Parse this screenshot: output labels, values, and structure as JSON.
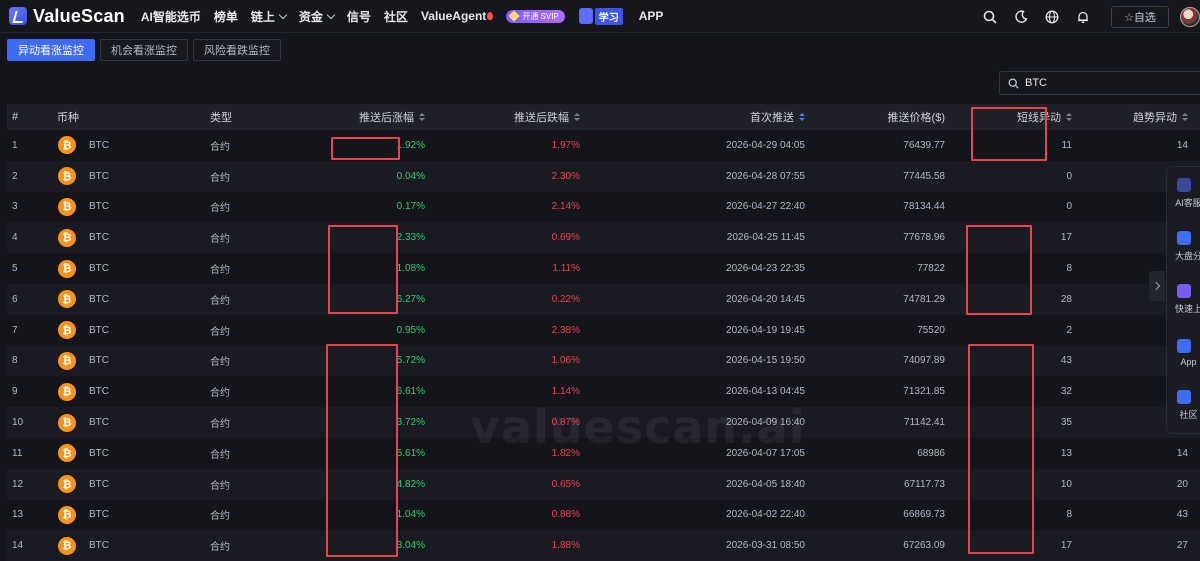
{
  "brand": {
    "name": "ValueScan"
  },
  "nav": {
    "items": [
      {
        "label": "AI智能选币",
        "has_dropdown": false
      },
      {
        "label": "榜单",
        "has_dropdown": false
      },
      {
        "label": "链上",
        "has_dropdown": true
      },
      {
        "label": "资金",
        "has_dropdown": true
      },
      {
        "label": "信号",
        "has_dropdown": false
      },
      {
        "label": "社区",
        "has_dropdown": false
      },
      {
        "label": "ValueAgent",
        "has_dropdown": false
      }
    ],
    "svip_label": "开通 SVIP",
    "learn_label": "学习",
    "app_label": "APP",
    "watchlist_label": "☆自选"
  },
  "tabs": [
    {
      "label": "异动看涨监控",
      "active": true
    },
    {
      "label": "机会看涨监控",
      "active": false
    },
    {
      "label": "风险看跌监控",
      "active": false
    }
  ],
  "search": {
    "value": "BTC"
  },
  "table": {
    "headers": {
      "idx": "#",
      "coin": "币种",
      "type": "类型",
      "up": "推送后涨幅",
      "down": "推送后跌幅",
      "time": "首次推送",
      "price": "推送价格($)",
      "short": "短线异动",
      "trend": "趋势异动"
    },
    "rows": [
      {
        "idx": "1",
        "coin": "BTC",
        "type": "合约",
        "up": "1.92%",
        "down": "1.97%",
        "time": "2026-04-29 04:05",
        "price": "76439.77",
        "short": "11",
        "trend": "14"
      },
      {
        "idx": "2",
        "coin": "BTC",
        "type": "合约",
        "up": "0.04%",
        "down": "2.30%",
        "time": "2026-04-28 07:55",
        "price": "77445.58",
        "short": "0",
        "trend": "5"
      },
      {
        "idx": "3",
        "coin": "BTC",
        "type": "合约",
        "up": "0.17%",
        "down": "2.14%",
        "time": "2026-04-27 22:40",
        "price": "78134.44",
        "short": "0",
        "trend": "1"
      },
      {
        "idx": "4",
        "coin": "BTC",
        "type": "合约",
        "up": "2.33%",
        "down": "0.69%",
        "time": "2026-04-25 11:45",
        "price": "77678.96",
        "short": "17",
        "trend": "34"
      },
      {
        "idx": "5",
        "coin": "BTC",
        "type": "合约",
        "up": "1.08%",
        "down": "1.11%",
        "time": "2026-04-23 22:35",
        "price": "77822",
        "short": "8",
        "trend": "16"
      },
      {
        "idx": "6",
        "coin": "BTC",
        "type": "合约",
        "up": "6.27%",
        "down": "0.22%",
        "time": "2026-04-20 14:45",
        "price": "74781.29",
        "short": "28",
        "trend": "30"
      },
      {
        "idx": "7",
        "coin": "BTC",
        "type": "合约",
        "up": "0.95%",
        "down": "2.38%",
        "time": "2026-04-19 19:45",
        "price": "75520",
        "short": "2",
        "trend": "4"
      },
      {
        "idx": "8",
        "coin": "BTC",
        "type": "合约",
        "up": "5.72%",
        "down": "1.06%",
        "time": "2026-04-15 19:50",
        "price": "74097.89",
        "short": "43",
        "trend": "39"
      },
      {
        "idx": "9",
        "coin": "BTC",
        "type": "合约",
        "up": "6.61%",
        "down": "1.14%",
        "time": "2026-04-13 04:45",
        "price": "71321.85",
        "short": "32",
        "trend": "38"
      },
      {
        "idx": "10",
        "coin": "BTC",
        "type": "合约",
        "up": "3.72%",
        "down": "0.87%",
        "time": "2026-04-09 16:40",
        "price": "71142.41",
        "short": "35",
        "trend": "41"
      },
      {
        "idx": "11",
        "coin": "BTC",
        "type": "合约",
        "up": "5.61%",
        "down": "1.82%",
        "time": "2026-04-07 17:05",
        "price": "68986",
        "short": "13",
        "trend": "14"
      },
      {
        "idx": "12",
        "coin": "BTC",
        "type": "合约",
        "up": "4.82%",
        "down": "0.65%",
        "time": "2026-04-05 18:40",
        "price": "67117.73",
        "short": "10",
        "trend": "20"
      },
      {
        "idx": "13",
        "coin": "BTC",
        "type": "合约",
        "up": "1.04%",
        "down": "0.88%",
        "time": "2026-04-02 22:40",
        "price": "66869.73",
        "short": "8",
        "trend": "43"
      },
      {
        "idx": "14",
        "coin": "BTC",
        "type": "合约",
        "up": "3.04%",
        "down": "1.88%",
        "time": "2026-03-31 08:50",
        "price": "67263.09",
        "short": "17",
        "trend": "27"
      }
    ]
  },
  "watermark": "valuescan.ai",
  "side_panel": [
    {
      "label": "AI客服",
      "color": "#3b4a9e"
    },
    {
      "label": "大盘分",
      "color": "#3d6df2"
    },
    {
      "label": "快速上",
      "color": "#7b5cf0"
    },
    {
      "label": "App",
      "color": "#3d6df2"
    },
    {
      "label": "社区",
      "color": "#3d6df2"
    }
  ],
  "colors": {
    "accent": "#3e6bf5",
    "up": "#2fcf6d",
    "down": "#f0414d",
    "highlight": "#e8444a"
  }
}
